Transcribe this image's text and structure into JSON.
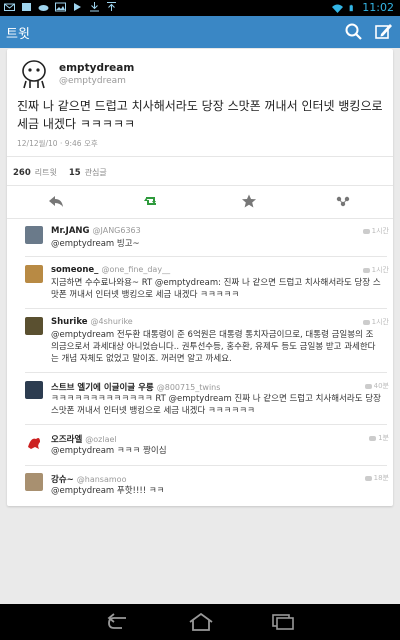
{
  "status_bar": {
    "time": "11:02"
  },
  "action_bar": {
    "title": "트윗"
  },
  "tweet": {
    "username": "emptydream",
    "handle": "@emptydream",
    "text": "진짜 나 같으면 드럽고 치사해서라도 당장 스맛폰 꺼내서 인터넷 뱅킹으로 세금 내겠다 ㅋㅋㅋㅋㅋ",
    "time": "12/12월/10 · 9:46 오후",
    "retweets": "260",
    "retweets_label": "리트윗",
    "favorites": "15",
    "favorites_label": "관심글"
  },
  "replies": [
    {
      "name": "Mr.JANG",
      "handle": "@JANG6363",
      "text": "@emptydream 빙고~",
      "time": "1시간",
      "avatar_color": "#6a7a8a"
    },
    {
      "name": "someone_",
      "handle": "@one_fine_day__",
      "text": "지금하면 수수료나와용~ RT @emptydream: 진짜 나 같으면 드럽고 치사해서라도 당장 스맛폰 꺼내서 인터넷 뱅킹으로 세금 내겠다 ㅋㅋㅋㅋㅋ",
      "time": "1시간",
      "avatar_color": "#b88a44"
    },
    {
      "name": "Shurike",
      "handle": "@4shurike",
      "text": "@emptydream 전두환 대통령이 준 6억원은 대통령 통치자금이므로, 대통령 금일봉의 조의금으로서 과세대상 아니었습니다.. 권투선수등, 홍수환, 유제두 등도 금일봉 받고 과세한다는 개념 자체도 없었고 말이죠. 꺼러면 알고 까세요.",
      "time": "1시간",
      "avatar_color": "#5a5030"
    },
    {
      "name": "스트브 엘기에 이글이글 우롱",
      "handle": "@800715_twins",
      "text": "ㅋㅋㅋㅋㅋㅋㅋㅋㅋㅋㅋㅋㅋ RT @emptydream 진짜 나 같으면 드럽고 치사해서라도 당장 스맛폰 꺼내서 인터넷 뱅킹으로 세금 내겠다 ㅋㅋㅋㅋㅋㅋ",
      "time": "40분",
      "avatar_color": "#2c3c50"
    },
    {
      "name": "오즈라엘",
      "handle": "@ozlael",
      "text": "@emptydream ㅋㅋㅋ 짱이심",
      "time": "1분",
      "avatar_color": "#cc2222"
    },
    {
      "name": "강슈~",
      "handle": "@hansamoo",
      "text": "@emptydream 푸핫!!!! ㅋㅋ",
      "time": "18분",
      "avatar_color": "#a89070"
    }
  ],
  "colors": {
    "action_bar": "#3a87c5",
    "retweet_green": "#2e9a3c"
  }
}
